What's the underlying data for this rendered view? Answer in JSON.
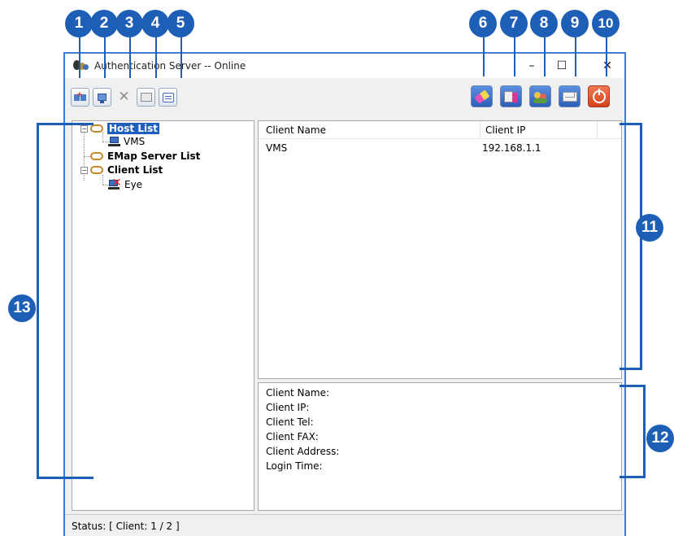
{
  "window": {
    "title": "Authentication Server -- Online",
    "minimize_glyph": "–",
    "maximize_glyph": "☐",
    "close_glyph": "✕"
  },
  "toolbar": {
    "left_buttons": [
      {
        "name": "add-host-icon"
      },
      {
        "name": "add-server-icon"
      },
      {
        "name": "delete-icon"
      },
      {
        "name": "properties-icon"
      },
      {
        "name": "message-icon"
      }
    ],
    "right_buttons": [
      {
        "name": "eraser-icon"
      },
      {
        "name": "settings-icon"
      },
      {
        "name": "users-icon"
      },
      {
        "name": "mail-icon"
      },
      {
        "name": "power-icon"
      }
    ]
  },
  "tree": {
    "host_list": "Host List",
    "vms": "VMS",
    "emap_server_list": "EMap Server List",
    "client_list": "Client List",
    "eye": "Eye"
  },
  "client_table": {
    "columns": [
      "Client Name",
      "Client IP"
    ],
    "rows": [
      {
        "name": "VMS",
        "ip": "192.168.1.1"
      }
    ]
  },
  "details": {
    "client_name": "Client Name:",
    "client_ip": "Client IP:",
    "client_tel": "Client Tel:",
    "client_fax": "Client FAX:",
    "client_address": "Client Address:",
    "login_time": "Login Time:"
  },
  "status": "Status: [ Client: 1 / 2 ]",
  "callouts": [
    "1",
    "2",
    "3",
    "4",
    "5",
    "6",
    "7",
    "8",
    "9",
    "10",
    "11",
    "12",
    "13"
  ],
  "colors": {
    "callout": "#1d5fb7",
    "selection": "#1e5fbf",
    "window_border": "#3b7dd8"
  }
}
